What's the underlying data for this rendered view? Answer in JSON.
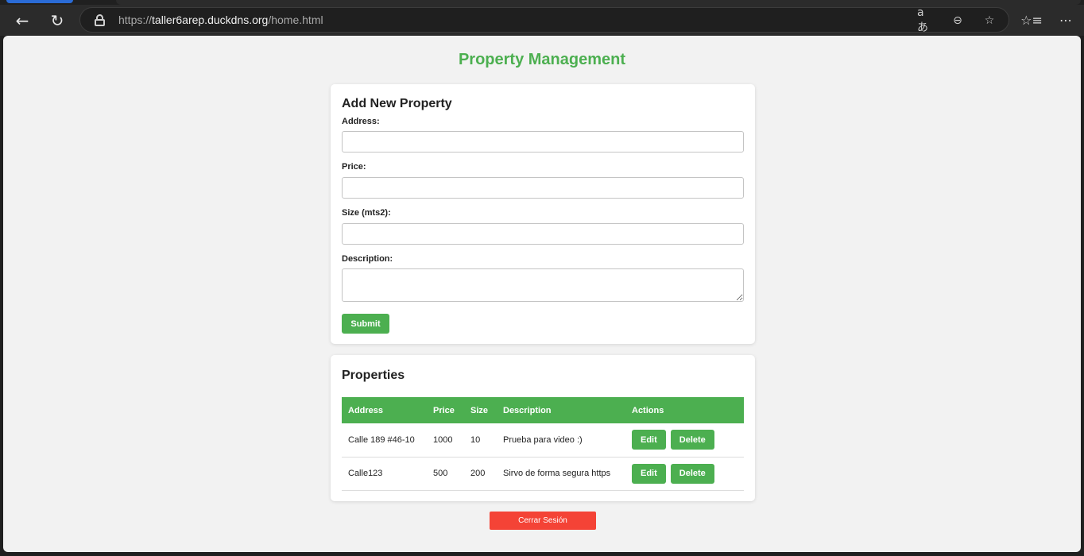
{
  "browser": {
    "url_scheme": "https://",
    "url_host": "taller6arep.duckdns.org",
    "url_path": "/home.html"
  },
  "page": {
    "title": "Property Management"
  },
  "form": {
    "heading": "Add New Property",
    "address_label": "Address:",
    "address_value": "",
    "price_label": "Price:",
    "price_value": "",
    "size_label": "Size (mts2):",
    "size_value": "",
    "description_label": "Description:",
    "description_value": "",
    "submit_label": "Submit"
  },
  "properties": {
    "heading": "Properties",
    "columns": [
      "Address",
      "Price",
      "Size",
      "Description",
      "Actions"
    ],
    "rows": [
      {
        "address": "Calle 189 #46-10",
        "price": "1000",
        "size": "10",
        "description": "Prueba para video :)",
        "edit_label": "Edit",
        "delete_label": "Delete"
      },
      {
        "address": "Calle123",
        "price": "500",
        "size": "200",
        "description": "Sirvo de forma segura https",
        "edit_label": "Edit",
        "delete_label": "Delete"
      }
    ]
  },
  "logout_label": "Cerrar Sesión",
  "colors": {
    "accent_green": "#4caf50",
    "logout_red": "#f44336",
    "page_background": "#f2f2f2"
  },
  "icons": [
    "back-icon",
    "reload-icon",
    "lock-icon",
    "translate-icon",
    "zoom-out-icon",
    "favorite-star-icon",
    "favorites-list-icon",
    "more-options-icon"
  ]
}
